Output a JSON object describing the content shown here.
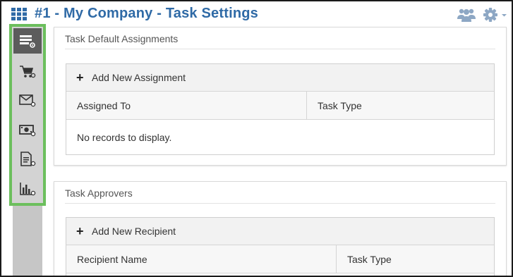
{
  "header": {
    "title": "#1 - My Company - Task Settings",
    "menu_icon": "grid-menu-icon",
    "users_icon": "users-icon",
    "settings_icon": "gear-icon"
  },
  "sidebar": {
    "items": [
      {
        "name": "task-settings",
        "icon": "list-settings-icon",
        "active": true
      },
      {
        "name": "cart-settings",
        "icon": "cart-settings-icon"
      },
      {
        "name": "email-settings",
        "icon": "envelope-settings-icon"
      },
      {
        "name": "billing-settings",
        "icon": "money-settings-icon"
      },
      {
        "name": "document-settings",
        "icon": "document-settings-icon"
      },
      {
        "name": "report-settings",
        "icon": "chart-settings-icon"
      }
    ]
  },
  "assignments": {
    "title": "Task Default Assignments",
    "add_label": "Add New Assignment",
    "columns": [
      "Assigned To",
      "Task Type"
    ],
    "empty": "No records to display."
  },
  "approvers": {
    "title": "Task Approvers",
    "add_label": "Add New Recipient",
    "columns": [
      "Recipient Name",
      "Task Type"
    ]
  },
  "colors": {
    "title": "#2f6aa6",
    "sidebar_highlight": "#6cbf5d",
    "active_item": "#5c5c5c",
    "icon_blue": "#2f6aa6"
  }
}
